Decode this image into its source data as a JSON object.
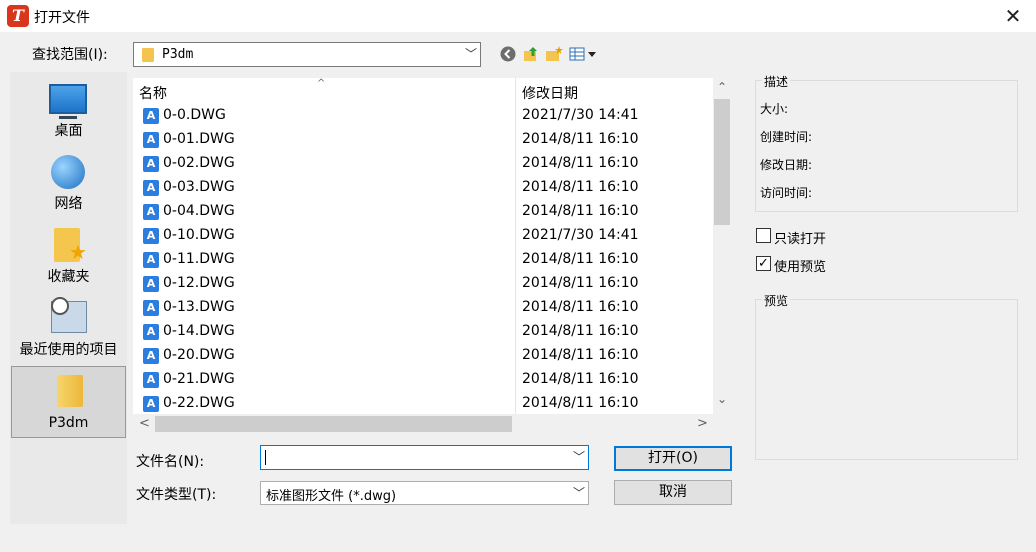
{
  "window": {
    "title": "打开文件",
    "app_icon_text": "T",
    "close_glyph": "✕"
  },
  "toolbar": {
    "lookin_label": "查找范围(I):",
    "lookin_value": "P3dm",
    "dropdown_glyph": "﹀",
    "icons": [
      "back-icon",
      "up-folder-icon",
      "new-folder-icon",
      "view-menu-icon"
    ]
  },
  "places": [
    {
      "label": "桌面",
      "icon": "desktop-icon"
    },
    {
      "label": "网络",
      "icon": "network-icon"
    },
    {
      "label": "收藏夹",
      "icon": "favorites-icon"
    },
    {
      "label": "最近使用的项目",
      "icon": "recent-items-icon"
    },
    {
      "label": "P3dm",
      "icon": "folder-icon",
      "selected": true
    }
  ],
  "list": {
    "col_name": "名称",
    "col_date": "修改日期",
    "sort_glyph": "^",
    "dwg_glyph": "A",
    "up_glyph": "⌃",
    "down_glyph": "⌄",
    "left_glyph": "<",
    "right_glyph": ">",
    "rows": [
      {
        "name": "0-0.DWG",
        "date": "2021/7/30 14:41"
      },
      {
        "name": "0-01.DWG",
        "date": "2014/8/11 16:10"
      },
      {
        "name": "0-02.DWG",
        "date": "2014/8/11 16:10"
      },
      {
        "name": "0-03.DWG",
        "date": "2014/8/11 16:10"
      },
      {
        "name": "0-04.DWG",
        "date": "2014/8/11 16:10"
      },
      {
        "name": "0-10.DWG",
        "date": "2021/7/30 14:41"
      },
      {
        "name": "0-11.DWG",
        "date": "2014/8/11 16:10"
      },
      {
        "name": "0-12.DWG",
        "date": "2014/8/11 16:10"
      },
      {
        "name": "0-13.DWG",
        "date": "2014/8/11 16:10"
      },
      {
        "name": "0-14.DWG",
        "date": "2014/8/11 16:10"
      },
      {
        "name": "0-20.DWG",
        "date": "2014/8/11 16:10"
      },
      {
        "name": "0-21.DWG",
        "date": "2014/8/11 16:10"
      },
      {
        "name": "0-22.DWG",
        "date": "2014/8/11 16:10"
      }
    ]
  },
  "form": {
    "filename_label": "文件名(N):",
    "filename_value": "",
    "filetype_label": "文件类型(T):",
    "filetype_value": "标准图形文件 (*.dwg)",
    "open_button": "打开(O)",
    "cancel_button": "取消"
  },
  "info": {
    "describe_title": "描述",
    "size_label": "大小:",
    "created_label": "创建时间:",
    "modified_label": "修改日期:",
    "accessed_label": "访问时间:",
    "readonly_label": "只读打开",
    "readonly_checked": false,
    "preview_check_label": "使用预览",
    "preview_checked": true,
    "check_glyph": "✓",
    "preview_title": "预览"
  }
}
